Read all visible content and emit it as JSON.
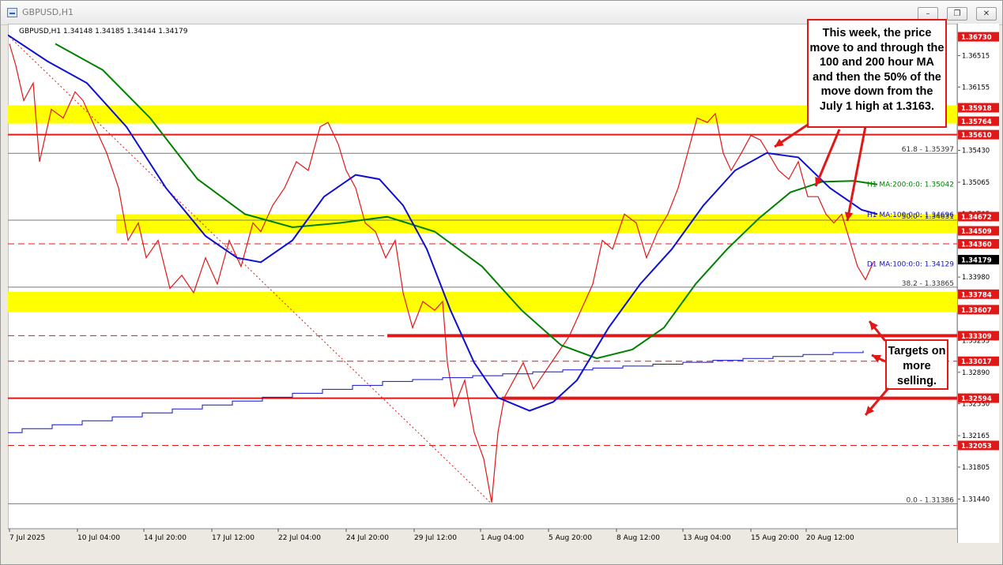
{
  "window": {
    "title": "GBPUSD,H1",
    "buttons": [
      "–",
      "❐",
      "✕"
    ]
  },
  "chart_data": {
    "type": "line",
    "symbol_info": "GBPUSD,H1  1.34148 1.34185 1.34144 1.34179",
    "y_ticks": [
      "1.36515",
      "1.36155",
      "1.35430",
      "1.35065",
      "1.34705",
      "1.33980",
      "1.33255",
      "1.32890",
      "1.32530",
      "1.32165",
      "1.31805",
      "1.31440"
    ],
    "x_ticks": [
      "7 Jul 2025",
      "10 Jul 04:00",
      "14 Jul 20:00",
      "17 Jul 12:00",
      "22 Jul 04:00",
      "24 Jul 20:00",
      "29 Jul 12:00",
      "1 Aug 04:00",
      "5 Aug 20:00",
      "8 Aug 12:00",
      "13 Aug 04:00",
      "15 Aug 20:00",
      "20 Aug 12:00"
    ],
    "ylim": [
      1.311,
      1.3688
    ],
    "level_labels": [
      {
        "value": 1.3673,
        "text": "1.36730",
        "color": "#e01818"
      },
      {
        "value": 1.35918,
        "text": "1.35918",
        "color": "#e01818"
      },
      {
        "value": 1.35764,
        "text": "1.35764",
        "color": "#e01818"
      },
      {
        "value": 1.3561,
        "text": "1.35610",
        "color": "#e01818"
      },
      {
        "value": 1.34672,
        "text": "1.34672",
        "color": "#e01818"
      },
      {
        "value": 1.34509,
        "text": "1.34509",
        "color": "#e01818"
      },
      {
        "value": 1.3436,
        "text": "1.34360",
        "color": "#e01818"
      },
      {
        "value": 1.34179,
        "text": "1.34179",
        "color": "#000000"
      },
      {
        "value": 1.33784,
        "text": "1.33784",
        "color": "#e01818"
      },
      {
        "value": 1.33607,
        "text": "1.33607",
        "color": "#e01818"
      },
      {
        "value": 1.33309,
        "text": "1.33309",
        "color": "#e01818"
      },
      {
        "value": 1.33017,
        "text": "1.33017",
        "color": "#e01818"
      },
      {
        "value": 1.32594,
        "text": "1.32594",
        "color": "#e01818"
      },
      {
        "value": 1.32053,
        "text": "1.32053",
        "color": "#e01818"
      }
    ],
    "yellow_zones": [
      {
        "from": 1.35764,
        "to": 1.35918
      },
      {
        "from": 1.34509,
        "to": 1.34672
      },
      {
        "from": 1.33607,
        "to": 1.33784
      }
    ],
    "fibonacci": [
      {
        "label": "61.8 - 1.35397",
        "value": 1.35397
      },
      {
        "label": "50.0 - 1.34631",
        "value": 1.34631
      },
      {
        "label": "38.2 - 1.33865",
        "value": 1.33865
      },
      {
        "label": "0.0 - 1.31386",
        "value": 1.31386
      }
    ],
    "indicators": [
      {
        "name": "H1 MA:200:0:0: 1.35042",
        "color": "#008000"
      },
      {
        "name": "H1 MA:100:0:0: 1.34696",
        "color": "#1010d0"
      },
      {
        "name": "D1 MA:100:0:0: 1.34129",
        "color": "#1010d0"
      }
    ]
  },
  "annotations": {
    "callout_top": "This week, the price move to and through the 100 and 200 hour MA and then the 50% of the move down from the July 1 high at 1.3163.",
    "callout_targets": "Targets on more selling."
  },
  "colors": {
    "zone": "#ffff00",
    "level_line": "#e01818",
    "candles": "#e01818",
    "ma100": "#1010d0",
    "ma200": "#008000"
  }
}
